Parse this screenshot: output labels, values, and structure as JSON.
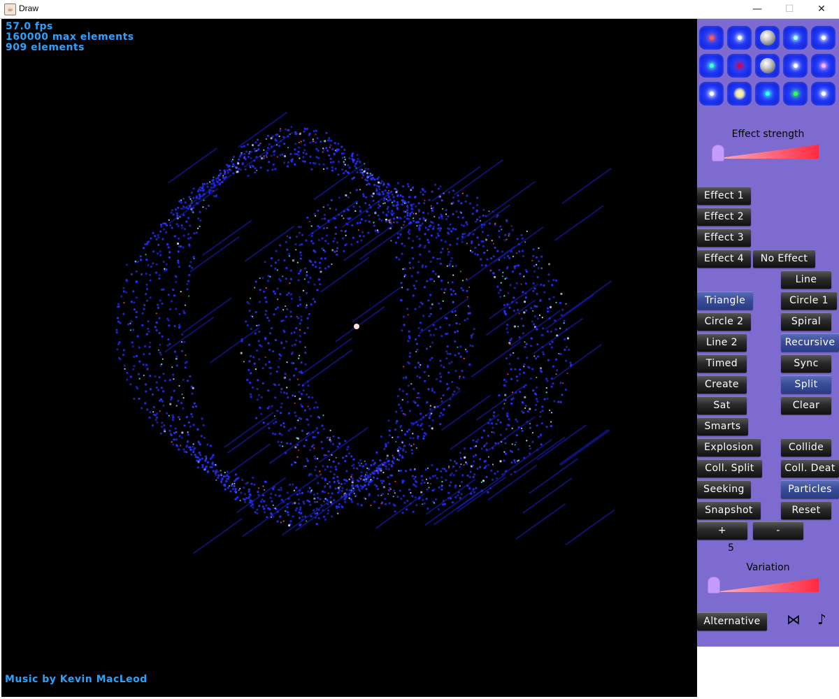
{
  "window": {
    "title": "Draw",
    "minimize": "—",
    "maximize": "☐",
    "close": "✕"
  },
  "stats": {
    "fps": "57.0 fps",
    "max": "160000 max elements",
    "count": "909 elements"
  },
  "credit": "Music by Kevin MacLeod",
  "palette": {
    "swatches": [
      {
        "kind": "dot",
        "color": "#ff5a5a"
      },
      {
        "kind": "dot",
        "color": "#ffffff"
      },
      {
        "kind": "ball",
        "color": "#cccccc"
      },
      {
        "kind": "dot",
        "color": "#aaffff"
      },
      {
        "kind": "dot",
        "color": "#ffffff"
      },
      {
        "kind": "dot",
        "color": "#40ffd0"
      },
      {
        "kind": "dot",
        "color": "#d0004a"
      },
      {
        "kind": "ball",
        "color": "#e0c090"
      },
      {
        "kind": "dot",
        "color": "#ffffff"
      },
      {
        "kind": "dot",
        "color": "#ffb0ff"
      },
      {
        "kind": "dot",
        "color": "#ffffff"
      },
      {
        "kind": "flower",
        "color": "#fff6d0"
      },
      {
        "kind": "dot",
        "color": "#33ffee"
      },
      {
        "kind": "dot",
        "color": "#33ff55"
      },
      {
        "kind": "dot",
        "color": "#ffffff"
      }
    ]
  },
  "effect_strength": {
    "label": "Effect strength",
    "value": 0.0
  },
  "variation": {
    "label": "Variation",
    "value": 0.0
  },
  "counter_value": "5",
  "buttons": {
    "effect1": "Effect  1",
    "effect2": "Effect  2",
    "effect3": "Effect  3",
    "effect4": "Effect  4",
    "no_effect": "No  Effect",
    "line": "Line",
    "triangle": "Triangle",
    "circle1": "Circle  1",
    "circle2": "Circle  2",
    "spiral": "Spiral",
    "line2": "Line  2",
    "recursive": "Recursive",
    "timed": "Timed",
    "sync": "Sync",
    "create": "Create",
    "split": "Split",
    "sat": "Sat",
    "clear": "Clear",
    "smarts": "Smarts",
    "explosion": "Explosion",
    "collide": "Collide",
    "coll_split": "Coll.  Split",
    "coll_death": "Coll.  Deat",
    "seeking": "Seeking",
    "particles": "Particles",
    "snapshot": "Snapshot",
    "reset": "Reset",
    "plus": "+",
    "minus": "-",
    "alternative": "Alternative"
  },
  "active_buttons": [
    "triangle",
    "recursive",
    "split",
    "particles"
  ],
  "icons": {
    "bowtie": "⋈",
    "music": "♪"
  }
}
